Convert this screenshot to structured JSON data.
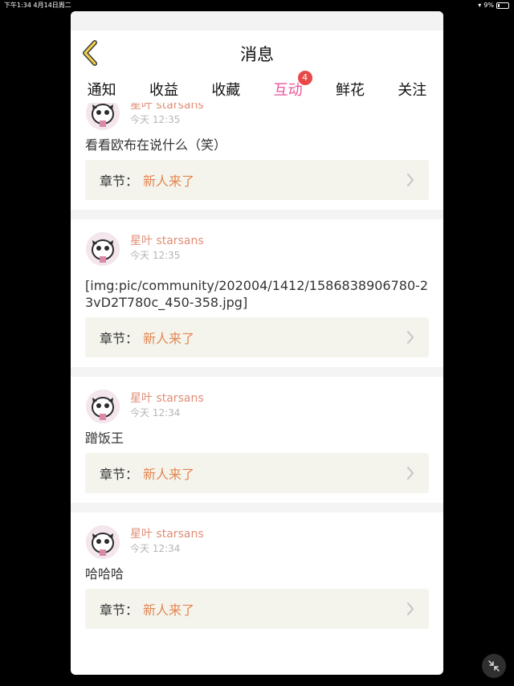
{
  "status_bar": {
    "time": "下午1:34",
    "date": "4月14日周二",
    "battery": "9%"
  },
  "header": {
    "title": "消息"
  },
  "tabs": [
    {
      "label": "通知",
      "active": false
    },
    {
      "label": "收益",
      "active": false
    },
    {
      "label": "收藏",
      "active": false
    },
    {
      "label": "互动",
      "active": true,
      "badge": "4"
    },
    {
      "label": "鲜花",
      "active": false
    },
    {
      "label": "关注",
      "active": false
    }
  ],
  "messages": [
    {
      "author": "星叶 starsans",
      "time": "今天 12:35",
      "text": "看看欧布在说什么（笑）",
      "chapter_label": "章节：",
      "chapter_title": "新人来了"
    },
    {
      "author": "星叶 starsans",
      "time": "今天 12:35",
      "text": "[img:pic/community/202004/1412/1586838906780-23vD2T780c_450-358.jpg]",
      "chapter_label": "章节：",
      "chapter_title": "新人来了"
    },
    {
      "author": "星叶 starsans",
      "time": "今天 12:34",
      "text": "蹭饭王",
      "chapter_label": "章节：",
      "chapter_title": "新人来了"
    },
    {
      "author": "星叶 starsans",
      "time": "今天 12:34",
      "text": "哈哈哈",
      "chapter_label": "章节：",
      "chapter_title": "新人来了"
    }
  ],
  "colors": {
    "accent": "#e9569a",
    "author_name": "#e08e76",
    "chapter_title": "#e4854f",
    "badge": "#e84848"
  }
}
